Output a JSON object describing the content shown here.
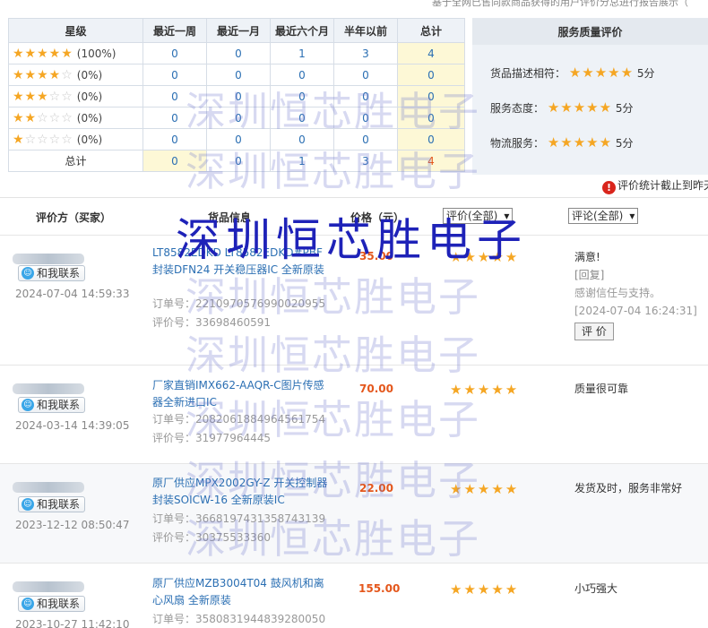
{
  "top_note": "基于全网已售同款商品获得的用户评价分总进行报告展示（",
  "stats": {
    "headers": [
      "星级",
      "最近一周",
      "最近一月",
      "最近六个月",
      "半年以前",
      "总计"
    ],
    "rows": [
      {
        "stars": 5,
        "pct": "(100%)",
        "values": [
          "0",
          "0",
          "1",
          "3",
          "4"
        ]
      },
      {
        "stars": 4,
        "pct": "(0%)",
        "values": [
          "0",
          "0",
          "0",
          "0",
          "0"
        ]
      },
      {
        "stars": 3,
        "pct": "(0%)",
        "values": [
          "0",
          "0",
          "0",
          "0",
          "0"
        ]
      },
      {
        "stars": 2,
        "pct": "(0%)",
        "values": [
          "0",
          "0",
          "0",
          "0",
          "0"
        ]
      },
      {
        "stars": 1,
        "pct": "(0%)",
        "values": [
          "0",
          "0",
          "0",
          "0",
          "0"
        ]
      }
    ],
    "total_label": "总计",
    "total_values": [
      "0",
      "0",
      "1",
      "3",
      "4"
    ]
  },
  "service": {
    "title": "服务质量评价",
    "items": [
      {
        "label": "货品描述相符：",
        "score": "5分",
        "stars": 5
      },
      {
        "label": "服务态度：",
        "score": "5分",
        "stars": 5
      },
      {
        "label": "物流服务：",
        "score": "5分",
        "stars": 5
      }
    ]
  },
  "cutoff_note": "评价统计截止到昨天",
  "review_header": {
    "rater": "评价方（买家）",
    "goods": "货品信息",
    "price": "价格（元）",
    "rating_select": "评价(全部)",
    "comment_select": "评论(全部)"
  },
  "contact_label": "和我联系",
  "order_prefix": "订单号：",
  "eval_prefix": "评价号：",
  "reviews": [
    {
      "date": "2024-07-04 14:59:33",
      "product": "LT8582EDKD LT8582EDKD#PBF 封装DFN24 开关稳压器IC 全新原装",
      "order": "2210970576990020955",
      "eval": "33698460591",
      "price": "35.00",
      "stars": 5,
      "comment": "满意!",
      "reply_label": "[回复]",
      "reply_text": "感谢信任与支持。",
      "reply_time": "[2024-07-04 16:24:31]",
      "button": "评 价"
    },
    {
      "date": "2024-03-14 14:39:05",
      "product": "厂家直销IMX662-AAQR-C图片传感器全新进口IC",
      "order": "2082061884964561754",
      "eval": "31977964445",
      "price": "70.00",
      "stars": 5,
      "comment": "质量很可靠"
    },
    {
      "date": "2023-12-12 08:50:47",
      "product": "原厂供应MPX2002GY-Z 开关控制器 封装SOICW-16 全新原装IC",
      "order": "3668197431358743139",
      "eval": "30375533360",
      "price": "22.00",
      "stars": 5,
      "comment": "发货及时，服务非常好"
    },
    {
      "date": "2023-10-27 11:42:10",
      "product": "原厂供应MZB3004T04 鼓风机和离心风扇 全新原装",
      "order": "3580831944839280050",
      "price": "155.00",
      "stars": 5,
      "comment": "小巧强大"
    }
  ],
  "watermark": "深圳恒芯胜电子",
  "watermark_bold": "深圳恒芯胜电子"
}
